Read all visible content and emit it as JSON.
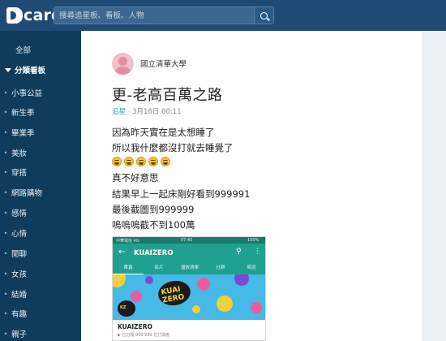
{
  "app": {
    "logo_text": "card",
    "search_placeholder": "搜尋追星板、看板、人物"
  },
  "sidebar": {
    "top_item": "全部",
    "category_label": "分類看板",
    "items": [
      {
        "label": "小事公益"
      },
      {
        "label": "新生季"
      },
      {
        "label": "畢業季"
      },
      {
        "label": "美妝"
      },
      {
        "label": "穿搭"
      },
      {
        "label": "網路購物"
      },
      {
        "label": "感情"
      },
      {
        "label": "心情"
      },
      {
        "label": "閒聊"
      },
      {
        "label": "女孩"
      },
      {
        "label": "結婚"
      },
      {
        "label": "有趣"
      },
      {
        "label": "親子"
      }
    ]
  },
  "post": {
    "school": "國立清華大學",
    "title": "更-老高百萬之路",
    "forum": "追星",
    "date": "3月16日 00:11",
    "lines": [
      "因為昨天實在是太想睡了",
      "所以我什麼都沒打就去睡覺了",
      "真不好意思",
      "結果早上一起床剛好看到999991",
      "最後截圖到999999",
      "嗚嗚嗚截不到100萬"
    ],
    "emoji_count": 5,
    "emoji_icon": "laughing-face-icon"
  },
  "screenshot": {
    "status_left": "中華電信 4G",
    "status_time": "07:45",
    "status_right": "100%",
    "channel_title": "KUAIZERO",
    "tabs": [
      "首頁",
      "影片",
      "播放清單",
      "社群",
      "頻道"
    ],
    "logo_text": "KUAI ZERO",
    "channel_name": "KUAIZERO",
    "subscribers": "▶ 已訂閱   999,999 位訂閱者"
  },
  "colors": {
    "topbar": "#1f4a73",
    "sidebar": "#0f3c5b",
    "accent_link": "#3397cf",
    "youtube_teal": "#20a190"
  }
}
